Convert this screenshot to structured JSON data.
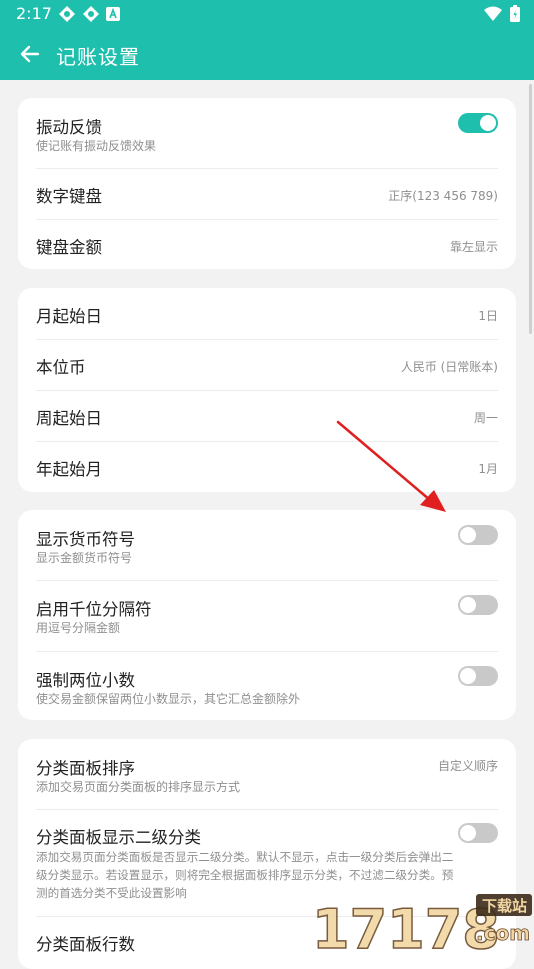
{
  "status_bar": {
    "time": "2:17",
    "icons": [
      "gear-notification-icon",
      "gear-notification-icon",
      "a-notification-icon",
      "wifi-icon",
      "battery-icon"
    ]
  },
  "app_bar": {
    "title": "记账设置",
    "back_icon": "arrow-left-icon"
  },
  "colors": {
    "accent": "#1fbfad",
    "toggle_off": "#c9c9c9",
    "annotation": "#e02020"
  },
  "card1": {
    "vibration": {
      "title": "振动反馈",
      "subtitle": "使记账有振动反馈效果",
      "on": true
    },
    "keypad": {
      "title": "数字键盘",
      "value": "正序(123 456 789)"
    },
    "amount": {
      "title": "键盘金额",
      "value": "靠左显示"
    }
  },
  "card2": {
    "month_start": {
      "title": "月起始日",
      "value": "1日"
    },
    "currency": {
      "title": "本位币",
      "value": "人民币 (日常账本)"
    },
    "week_start": {
      "title": "周起始日",
      "value": "周一"
    },
    "year_start": {
      "title": "年起始月",
      "value": "1月"
    }
  },
  "card3": {
    "currency_symbol": {
      "title": "显示货币符号",
      "subtitle": "显示金额货币符号",
      "on": false
    },
    "thousands": {
      "title": "启用千位分隔符",
      "subtitle": "用逗号分隔金额",
      "on": false
    },
    "two_decimals": {
      "title": "强制两位小数",
      "subtitle": "使交易金额保留两位小数显示，其它汇总金额除外",
      "on": false
    }
  },
  "card4": {
    "panel_sort": {
      "title": "分类面板排序",
      "subtitle": "添加交易页面分类面板的排序显示方式",
      "value": "自定义顺序"
    },
    "panel_level2": {
      "title": "分类面板显示二级分类",
      "subtitle_lines": [
        "添加交易页面分类面板是否显示二级分类。默认不显示，点击一级分类后会弹出二",
        "级分类显示。若设置显示，则将完全根据面板排序显示分类，不过滤二级分类。预",
        "测的首选分类不受此设置影响"
      ],
      "on": false
    },
    "panel_rows": {
      "title": "分类面板行数"
    }
  },
  "watermark": {
    "text": "17178",
    "badge": "下载站",
    "suffix": ".com"
  }
}
